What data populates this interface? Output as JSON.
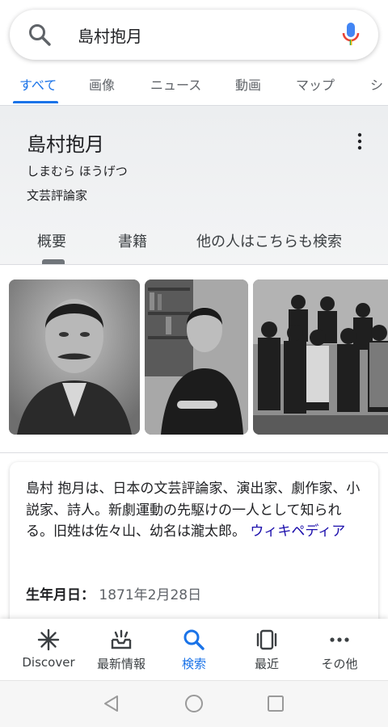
{
  "search": {
    "query": "島村抱月"
  },
  "tabs": [
    {
      "label": "すべて",
      "active": true
    },
    {
      "label": "画像"
    },
    {
      "label": "ニュース"
    },
    {
      "label": "動画"
    },
    {
      "label": "マップ"
    },
    {
      "label": "シ"
    }
  ],
  "knowledge_panel": {
    "title": "島村抱月",
    "reading": "しまむら ほうげつ",
    "type": "文芸評論家",
    "tabs": [
      "概要",
      "書籍",
      "他の人はこちらも検索"
    ]
  },
  "images": [
    {
      "icon": "portrait-photo"
    },
    {
      "icon": "seated-portrait-photo"
    },
    {
      "icon": "group-photo"
    }
  ],
  "description": {
    "text": "島村 抱月は、日本の文芸評論家、演出家、劇作家、小説家、詩人。新劇運動の先駆けの一人として知られる。旧姓は佐々山、幼名は瀧太郎。",
    "source_link": "ウィキペディア",
    "birth_label": "生年月日：",
    "birth_value": "1871年2月28日"
  },
  "bottom_nav": [
    {
      "label": "Discover",
      "icon": "asterisk-icon"
    },
    {
      "label": "最新情報",
      "icon": "updates-tray-icon"
    },
    {
      "label": "検索",
      "icon": "search-icon",
      "active": true
    },
    {
      "label": "最近",
      "icon": "recent-tabs-icon"
    },
    {
      "label": "その他",
      "icon": "more-horiz-icon"
    }
  ],
  "colors": {
    "accent": "#1a73e8",
    "link": "#1a0dab",
    "text": "#202124",
    "secondary": "#5f6368"
  }
}
